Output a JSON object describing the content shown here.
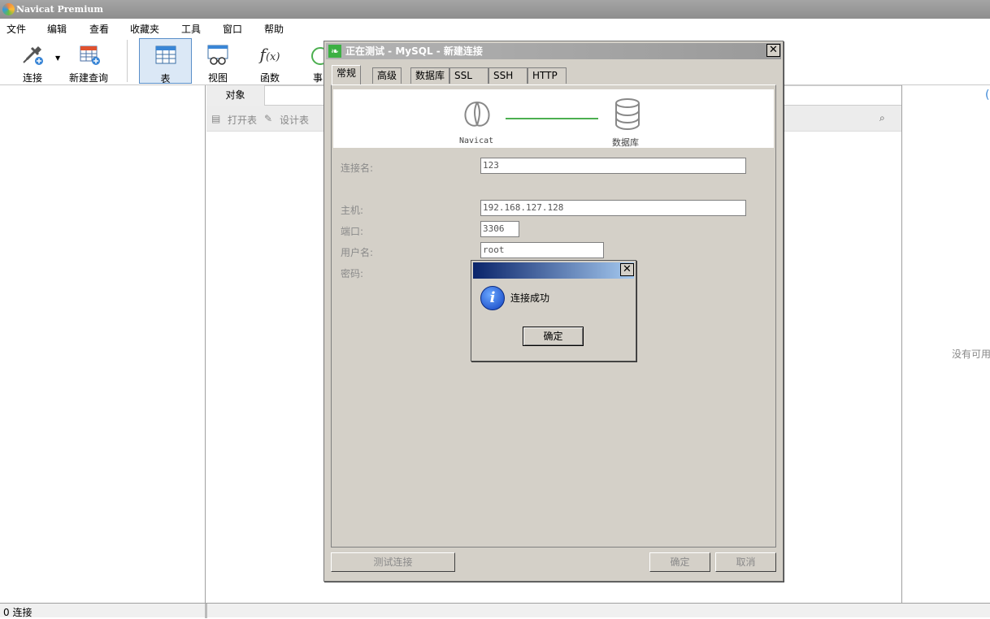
{
  "app_title": "Navicat Premium",
  "menu": [
    "文件",
    "编辑",
    "查看",
    "收藏夹",
    "工具",
    "窗口",
    "帮助"
  ],
  "toolbar": {
    "connect": "连接",
    "new_query": "新建查询",
    "table": "表",
    "view": "视图",
    "function": "函数",
    "event": "事"
  },
  "object_tab": "对象",
  "object_toolbar": {
    "open_table": "打开表",
    "design_table": "设计表"
  },
  "right_pane_text": "没有可用",
  "status": {
    "connections": "0 连接"
  },
  "dialog": {
    "title": "正在测试 - MySQL - 新建连接",
    "tabs": [
      "常规",
      "高级",
      "数据库",
      "SSL",
      "SSH",
      "HTTP"
    ],
    "banner_left": "Navicat",
    "banner_right": "数据库",
    "labels": {
      "conn_name": "连接名:",
      "host": "主机:",
      "port": "端口:",
      "user": "用户名:",
      "password": "密码:"
    },
    "values": {
      "conn_name": "123",
      "host": "192.168.127.128",
      "port": "3306",
      "user": "root"
    },
    "test_button": "测试连接",
    "ok_button": "确定",
    "cancel_button": "取消"
  },
  "message_box": {
    "text": "连接成功",
    "ok": "确定"
  },
  "colors": {
    "banner_line": "#4caf50",
    "dialog_bg": "#d4d0c8",
    "msg_title_start": "#0a246a",
    "msg_title_end": "#a6caf0"
  }
}
